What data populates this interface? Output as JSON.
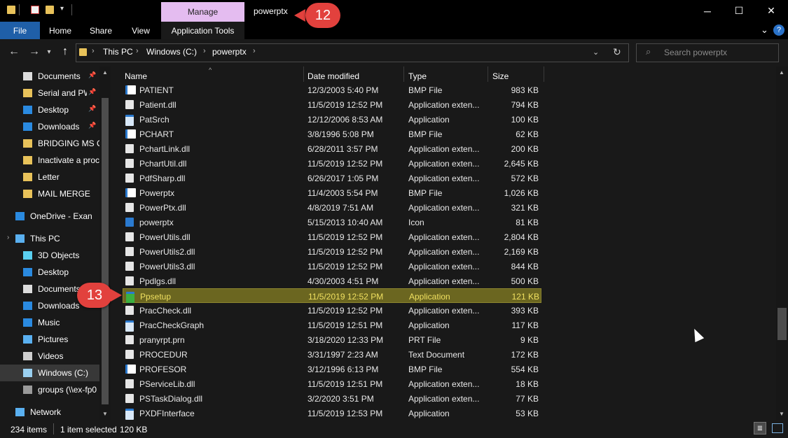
{
  "window": {
    "title": "powerptx",
    "manage_tab": "Manage",
    "minimize": "─",
    "maximize": "☐",
    "close": "✕"
  },
  "ribbon": {
    "tabs": [
      "File",
      "Home",
      "Share",
      "View",
      "Application Tools"
    ],
    "help": "?"
  },
  "address": {
    "crumbs": [
      "This PC",
      "Windows (C:)",
      "powerptx"
    ],
    "search_placeholder": "Search powerptx"
  },
  "nav": {
    "items": [
      {
        "label": "Documents",
        "icon": "documents-icon",
        "pinned": true
      },
      {
        "label": "Serial and PW",
        "icon": "folder-icon",
        "pinned": true
      },
      {
        "label": "Desktop",
        "icon": "desktop-icon",
        "pinned": true
      },
      {
        "label": "Downloads",
        "icon": "downloads-icon",
        "pinned": true
      },
      {
        "label": "BRIDGING MS O",
        "icon": "folder-icon",
        "pinned": false
      },
      {
        "label": "Inactivate a proc",
        "icon": "folder-icon",
        "pinned": false
      },
      {
        "label": "Letter",
        "icon": "folder-icon",
        "pinned": false
      },
      {
        "label": "MAIL MERGE",
        "icon": "folder-icon",
        "pinned": false
      },
      {
        "label": "OneDrive - Exan",
        "icon": "onedrive-icon",
        "pinned": false
      },
      {
        "label": "This PC",
        "icon": "computer-icon",
        "pinned": false
      },
      {
        "label": "3D Objects",
        "icon": "3d-objects-icon",
        "pinned": false
      },
      {
        "label": "Desktop",
        "icon": "desktop-icon",
        "pinned": false
      },
      {
        "label": "Documents",
        "icon": "documents-icon",
        "pinned": false
      },
      {
        "label": "Downloads",
        "icon": "downloads-icon",
        "pinned": false
      },
      {
        "label": "Music",
        "icon": "music-icon",
        "pinned": false
      },
      {
        "label": "Pictures",
        "icon": "pictures-icon",
        "pinned": false
      },
      {
        "label": "Videos",
        "icon": "videos-icon",
        "pinned": false
      },
      {
        "label": "Windows (C:)",
        "icon": "drive-icon",
        "pinned": false
      },
      {
        "label": "groups (\\\\ex-fp0",
        "icon": "network-drive-icon",
        "pinned": false
      },
      {
        "label": "Network",
        "icon": "network-icon",
        "pinned": false
      }
    ]
  },
  "columns": {
    "name": "Name",
    "date": "Date modified",
    "type": "Type",
    "size": "Size"
  },
  "files": [
    {
      "name": "PATIENT",
      "date": "12/3/2003 5:40 PM",
      "type": "BMP File",
      "size": "983 KB"
    },
    {
      "name": "Patient.dll",
      "date": "11/5/2019 12:52 PM",
      "type": "Application exten...",
      "size": "794 KB"
    },
    {
      "name": "PatSrch",
      "date": "12/12/2006 8:53 AM",
      "type": "Application",
      "size": "100 KB"
    },
    {
      "name": "PCHART",
      "date": "3/8/1996 5:08 PM",
      "type": "BMP File",
      "size": "62 KB"
    },
    {
      "name": "PchartLink.dll",
      "date": "6/28/2011 3:57 PM",
      "type": "Application exten...",
      "size": "200 KB"
    },
    {
      "name": "PchartUtil.dll",
      "date": "11/5/2019 12:52 PM",
      "type": "Application exten...",
      "size": "2,645 KB"
    },
    {
      "name": "PdfSharp.dll",
      "date": "6/26/2017 1:05 PM",
      "type": "Application exten...",
      "size": "572 KB"
    },
    {
      "name": "Powerptx",
      "date": "11/4/2003 5:54 PM",
      "type": "BMP File",
      "size": "1,026 KB"
    },
    {
      "name": "PowerPtx.dll",
      "date": "4/8/2019 7:51 AM",
      "type": "Application exten...",
      "size": "321 KB"
    },
    {
      "name": "powerptx",
      "date": "5/15/2013 10:40 AM",
      "type": "Icon",
      "size": "81 KB"
    },
    {
      "name": "PowerUtils.dll",
      "date": "11/5/2019 12:52 PM",
      "type": "Application exten...",
      "size": "2,804 KB"
    },
    {
      "name": "PowerUtils2.dll",
      "date": "11/5/2019 12:52 PM",
      "type": "Application exten...",
      "size": "2,169 KB"
    },
    {
      "name": "PowerUtils3.dll",
      "date": "11/5/2019 12:52 PM",
      "type": "Application exten...",
      "size": "844 KB"
    },
    {
      "name": "Ppdlgs.dll",
      "date": "4/30/2003 4:51 PM",
      "type": "Application exten...",
      "size": "500 KB"
    },
    {
      "name": "Ppsetup",
      "date": "11/5/2019 12:52 PM",
      "type": "Application",
      "size": "121 KB",
      "selected": true
    },
    {
      "name": "PracCheck.dll",
      "date": "11/5/2019 12:52 PM",
      "type": "Application exten...",
      "size": "393 KB"
    },
    {
      "name": "PracCheckGraph",
      "date": "11/5/2019 12:51 PM",
      "type": "Application",
      "size": "117 KB"
    },
    {
      "name": "pranyrpt.prn",
      "date": "3/18/2020 12:33 PM",
      "type": "PRT File",
      "size": "9 KB"
    },
    {
      "name": "PROCEDUR",
      "date": "3/31/1997 2:23 AM",
      "type": "Text Document",
      "size": "172 KB"
    },
    {
      "name": "PROFESOR",
      "date": "3/12/1996 6:13 PM",
      "type": "BMP File",
      "size": "554 KB"
    },
    {
      "name": "PServiceLib.dll",
      "date": "11/5/2019 12:51 PM",
      "type": "Application exten...",
      "size": "18 KB"
    },
    {
      "name": "PSTaskDialog.dll",
      "date": "3/2/2020 3:51 PM",
      "type": "Application exten...",
      "size": "77 KB"
    },
    {
      "name": "PXDFInterface",
      "date": "11/5/2019 12:53 PM",
      "type": "Application",
      "size": "53 KB"
    }
  ],
  "status": {
    "count": "234 items",
    "selected": "1 item selected",
    "selected_size": "120 KB"
  },
  "callouts": {
    "first": "12",
    "second": "13"
  },
  "colors": {
    "background": "#191919",
    "titlebar": "#000000",
    "manage_tab": "#e4bcf0",
    "file_tab": "#1f5fa8",
    "selection": "#6b6620",
    "selection_text": "#f0e060",
    "callout": "#e2413d"
  }
}
